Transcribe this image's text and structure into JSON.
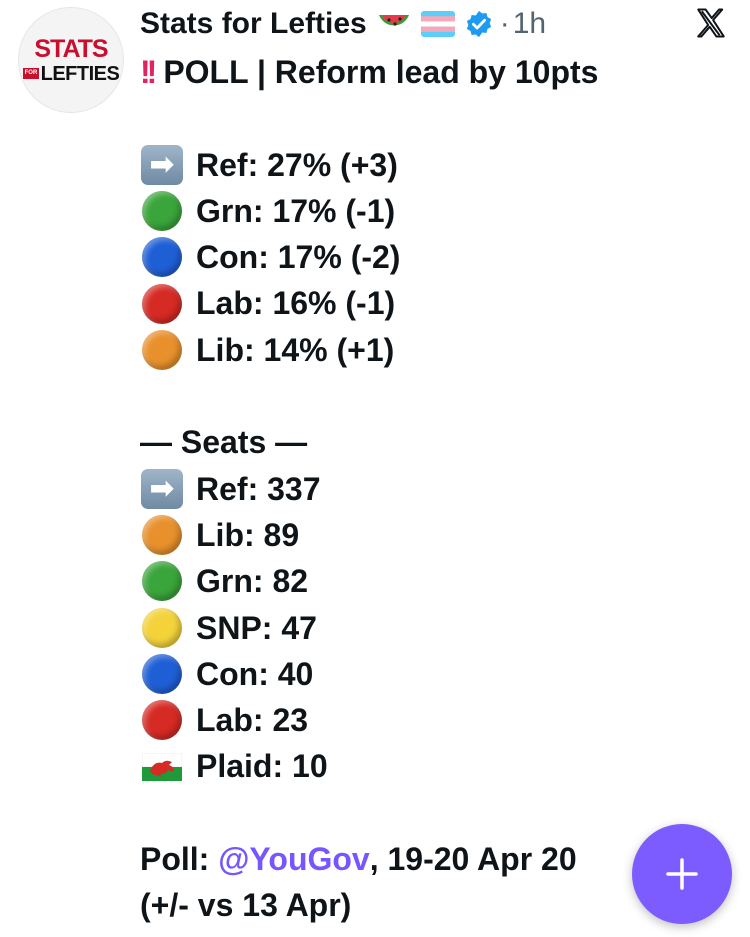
{
  "author": {
    "name": "Stats for Lefties",
    "avatar_text_top": "STATS",
    "avatar_text_for": "FOR",
    "avatar_text_bottom": "LEFTIES",
    "emojis": [
      "watermelon-icon",
      "transgender-flag-icon"
    ],
    "verified_icon": "verified-badge-icon",
    "separator": "·",
    "time": "1h"
  },
  "platform_icon": "x-logo-icon",
  "post": {
    "headline_icon": "double-exclamation-icon",
    "headline_icon_text": "!!",
    "headline": "POLL | Reform lead by 10pts",
    "poll_lines": [
      {
        "icon": "right-arrow-icon",
        "color": "#7f9bb5",
        "text": "Ref: 27% (+3)"
      },
      {
        "icon": "green-circle-icon",
        "color": "#3aa53a",
        "text": "Grn: 17% (-1)"
      },
      {
        "icon": "blue-circle-icon",
        "color": "#1f5fd6",
        "text": "Con: 17% (-2)"
      },
      {
        "icon": "red-circle-icon",
        "color": "#d62a24",
        "text": "Lab: 16% (-1)"
      },
      {
        "icon": "orange-circle-icon",
        "color": "#e8902c",
        "text": "Lib: 14% (+1)"
      }
    ],
    "seats_heading": "— Seats —",
    "seat_lines": [
      {
        "icon": "right-arrow-icon",
        "color": "#7f9bb5",
        "text": "Ref: 337"
      },
      {
        "icon": "orange-circle-icon",
        "color": "#e8902c",
        "text": "Lib: 89"
      },
      {
        "icon": "green-circle-icon",
        "color": "#3aa53a",
        "text": "Grn: 82"
      },
      {
        "icon": "yellow-circle-icon",
        "color": "#f3d23a",
        "text": "SNP: 47"
      },
      {
        "icon": "blue-circle-icon",
        "color": "#1f5fd6",
        "text": "Con: 40"
      },
      {
        "icon": "red-circle-icon",
        "color": "#d62a24",
        "text": "Lab: 23"
      },
      {
        "icon": "wales-flag-icon",
        "color": "#d62a24",
        "text": "Plaid: 10"
      }
    ],
    "source_prefix": "Poll: ",
    "source_mention": "@YouGov",
    "source_suffix": ", 19-20 Apr 20",
    "comparison": "(+/- vs 13 Apr)"
  },
  "fab": {
    "icon": "plus-icon",
    "color": "#7c5cff"
  }
}
